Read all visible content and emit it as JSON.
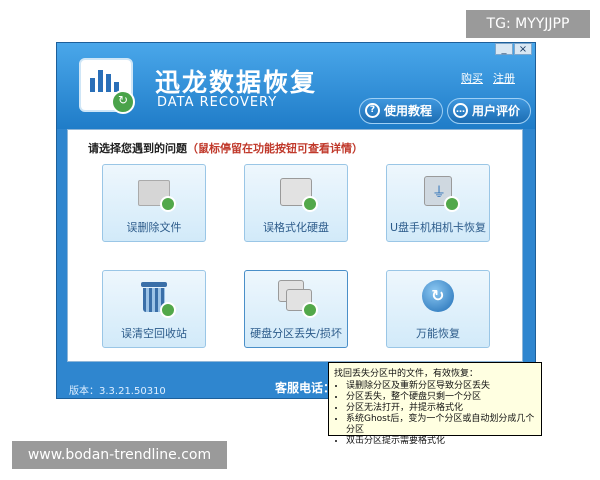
{
  "watermarks": {
    "top_right": "TG: MYYJJPP",
    "bottom_left": "www.bodan-trendline.com"
  },
  "window": {
    "controls": {
      "minimize": "_",
      "close": "×"
    }
  },
  "header": {
    "title": "迅龙数据恢复",
    "subtitle": "DATA RECOVERY",
    "links": {
      "buy": "购买",
      "register": "注册"
    },
    "buttons": {
      "tutorial": "使用教程",
      "review": "用户评价"
    }
  },
  "main": {
    "prompt": "请选择您遇到的问题",
    "hint": "（鼠标停留在功能按钮可查看详情）",
    "tiles": [
      {
        "label": "误删除文件",
        "icon": "folder-recover-icon"
      },
      {
        "label": "误格式化硬盘",
        "icon": "disk-recover-icon"
      },
      {
        "label": "U盘手机相机卡恢复",
        "icon": "usb-recover-icon"
      },
      {
        "label": "误清空回收站",
        "icon": "recycle-bin-icon"
      },
      {
        "label": "硬盘分区丢失/损坏",
        "icon": "partition-recover-icon"
      },
      {
        "label": "万能恢复",
        "icon": "universal-recover-icon"
      }
    ]
  },
  "footer": {
    "version": "版本：3.3.21.50310",
    "service": "客服电话："
  },
  "tooltip": {
    "title": "找回丢失分区中的文件，有效恢复：",
    "items": [
      "误删除分区及重新分区导致分区丢失",
      "分区丢失，整个硬盘只剩一个分区",
      "分区无法打开，并提示格式化",
      "系统Ghost后，变为一个分区或自动划分成几个分区",
      "双击分区提示需要格式化"
    ]
  },
  "colors": {
    "accent": "#2f86cf",
    "hint": "#c0392b",
    "tooltip_bg": "#ffffe1"
  }
}
